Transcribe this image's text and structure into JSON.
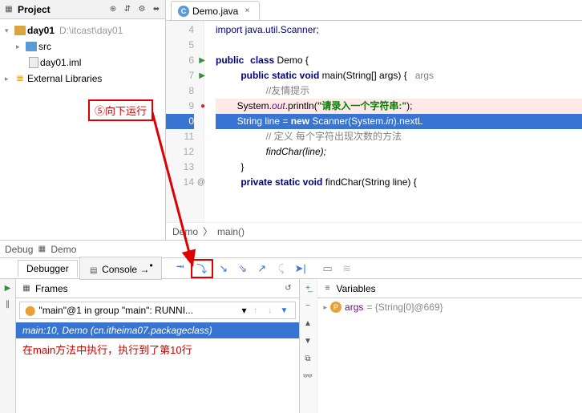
{
  "project": {
    "title": "Project",
    "tree": {
      "root": "day01",
      "rootPath": "D:\\itcast\\day01",
      "src": "src",
      "iml": "day01.iml",
      "extLib": "External Libraries"
    }
  },
  "editor": {
    "tab": "Demo.java",
    "breadcrumb": {
      "a": "Demo",
      "b": "main()"
    },
    "lines": {
      "l4": "import java.util.Scanner;",
      "l6_a": "public",
      "l6_b": "class",
      "l6_c": " Demo {",
      "l7_a": "public static void",
      "l7_b": " main(String[] args) {   ",
      "l7_c": "args",
      "l8": "//友情提示",
      "l9_a": "System.",
      "l9_b": "out",
      "l9_c": ".println(",
      "l9_d": "\"请录入一个字符串:\"",
      "l9_e": ");",
      "l10_a": "String line = ",
      "l10_b": "new",
      "l10_c": " Scanner(System.",
      "l10_d": "in",
      "l10_e": ").nextL",
      "l11": "// 定义 每个字符出现次数的方法",
      "l12": "findChar(line);",
      "l13": "}",
      "l14_a": "private static void",
      "l14_b": " findChar(String line) {"
    },
    "gutterStart": 4
  },
  "callout": "⑤向下运行",
  "debug": {
    "title": "Debug",
    "target": "Demo",
    "tabs": {
      "debugger": "Debugger",
      "console": "Console"
    },
    "frames": {
      "title": "Frames",
      "combo": "\"main\"@1 in group \"main\": RUNNI...",
      "row": "main:10, Demo (cn.itheima07.packageclass)"
    },
    "note": "在main方法中执行，执行到了第10行",
    "vars": {
      "title": "Variables",
      "arg": "args",
      "argVal": " = {String[0]@669}"
    }
  }
}
